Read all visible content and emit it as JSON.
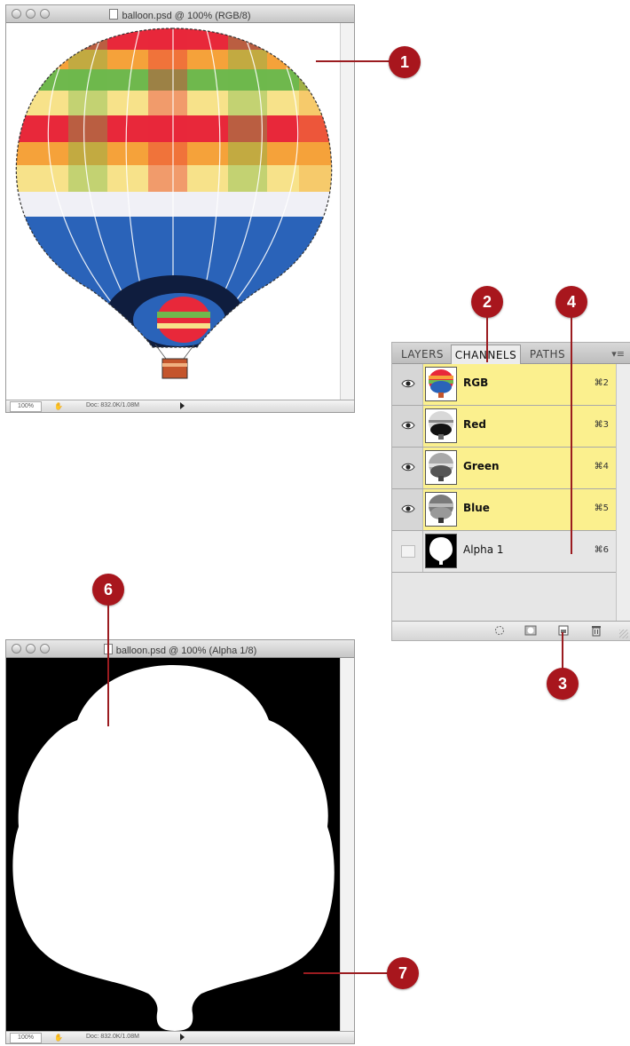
{
  "rgb_window": {
    "title": "balloon.psd @ 100% (RGB/8)",
    "zoom": "100%",
    "doc_info": "Doc: 832.0K/1.08M"
  },
  "alpha_window": {
    "title": "balloon.psd @ 100% (Alpha 1/8)",
    "zoom": "100%",
    "doc_info": "Doc: 832.0K/1.08M"
  },
  "channels_panel": {
    "tabs": [
      "LAYERS",
      "CHANNELS",
      "PATHS"
    ],
    "active_tab": "CHANNELS",
    "rows": [
      {
        "name": "RGB",
        "shortcut": "⌘2",
        "visible": true,
        "selected": true
      },
      {
        "name": "Red",
        "shortcut": "⌘3",
        "visible": true,
        "selected": true
      },
      {
        "name": "Green",
        "shortcut": "⌘4",
        "visible": true,
        "selected": true
      },
      {
        "name": "Blue",
        "shortcut": "⌘5",
        "visible": true,
        "selected": true
      },
      {
        "name": "Alpha 1",
        "shortcut": "⌘6",
        "visible": false,
        "selected": false
      }
    ],
    "footer_buttons": [
      "load-selection",
      "save-selection",
      "new-channel",
      "delete-channel"
    ]
  },
  "callouts": [
    "1",
    "2",
    "3",
    "4",
    "6",
    "7"
  ],
  "colors": {
    "callout": "#a8161d",
    "selected_row": "#fbf08e",
    "balloon_red": "#e8283a",
    "balloon_orange": "#f5a23a",
    "balloon_yellow": "#f7e28a",
    "balloon_green": "#6fb84d",
    "balloon_blue": "#2a63b9"
  }
}
